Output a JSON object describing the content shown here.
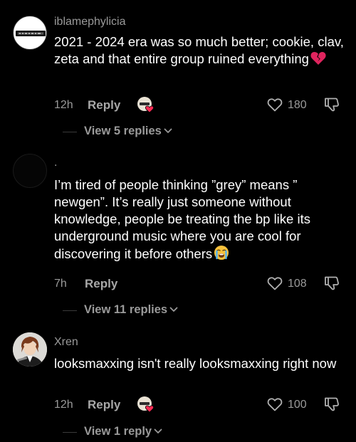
{
  "comments": [
    {
      "username": "iblamephylicia",
      "text": "2021 - 2024 era was so much better; cookie, clav, zeta and that entire group ruined everything",
      "emoji": "broken-heart",
      "time": "12h",
      "reply_label": "Reply",
      "creator_liked": true,
      "likes": "180",
      "view_replies": "View 5 replies"
    },
    {
      "username": ".",
      "text": "I’m tired of people thinking ”grey” means ” newgen”. It’s really just someone without knowledge, people be treating the bp like its underground music where you are cool for discovering it before others",
      "emoji": "loudly-crying-face",
      "time": "7h",
      "reply_label": "Reply",
      "creator_liked": false,
      "likes": "108",
      "view_replies": "View 11 replies"
    },
    {
      "username": "Xren",
      "text": "looksmaxxing isn't really looksmaxxing right now",
      "emoji": "",
      "time": "12h",
      "reply_label": "Reply",
      "creator_liked": true,
      "likes": "100",
      "view_replies": "View 1 reply"
    }
  ],
  "colors": {
    "background": "#000000",
    "primary_text": "#ffffff",
    "secondary_text": "#9a9a9a",
    "like_heart": "#fe2c55"
  },
  "icons": {
    "like": "heart-outline-icon",
    "dislike": "thumbs-down-icon",
    "expand": "chevron-down-icon",
    "creator_liked": "creator-liked-avatar-heart-icon"
  }
}
